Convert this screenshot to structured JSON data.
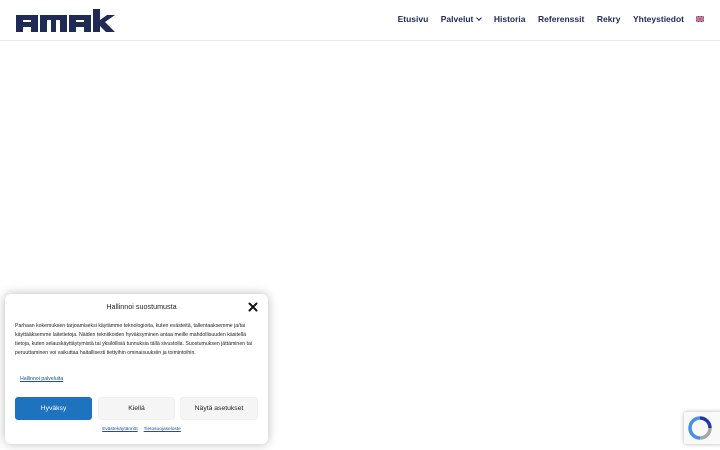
{
  "header": {
    "logo_text": "amak",
    "nav": [
      {
        "label": "Etusivu",
        "has_dropdown": false
      },
      {
        "label": "Palvelut",
        "has_dropdown": true
      },
      {
        "label": "Historia",
        "has_dropdown": false
      },
      {
        "label": "Referenssit",
        "has_dropdown": false
      },
      {
        "label": "Rekry",
        "has_dropdown": false
      },
      {
        "label": "Yhteystiedot",
        "has_dropdown": false
      }
    ],
    "language_icon": "uk-flag-icon"
  },
  "consent": {
    "title": "Hallinnoi suostumusta",
    "body": "Parhaan kokemuksen tarjoamiseksi käytämme teknologioita, kuten evästeitä, tallentaaksemme ja/tai käyttääksemme laitetietoja. Näiden tekniikoiden hyväksyminen antaa meille mahdollisuuden käsitellä tietoja, kuten selauskäyttäytymistä tai yksilöllisiä tunnuksia tällä sivustolla. Suostumuksen jättäminen tai peruuttaminen voi vaikuttaa haitallisesti tiettyihin ominaisuuksiin ja toimintoihin.",
    "manage_link": "Hallinnoi palveluita",
    "accept_label": "Hyväksy",
    "deny_label": "Kiellä",
    "settings_label": "Näytä asetukset",
    "cookie_policy_link": "Evästekäytännöt",
    "privacy_link": "Tietosuojaseloste",
    "accent_color": "#1e73be"
  },
  "recaptcha": {
    "icon": "recaptcha-icon"
  }
}
